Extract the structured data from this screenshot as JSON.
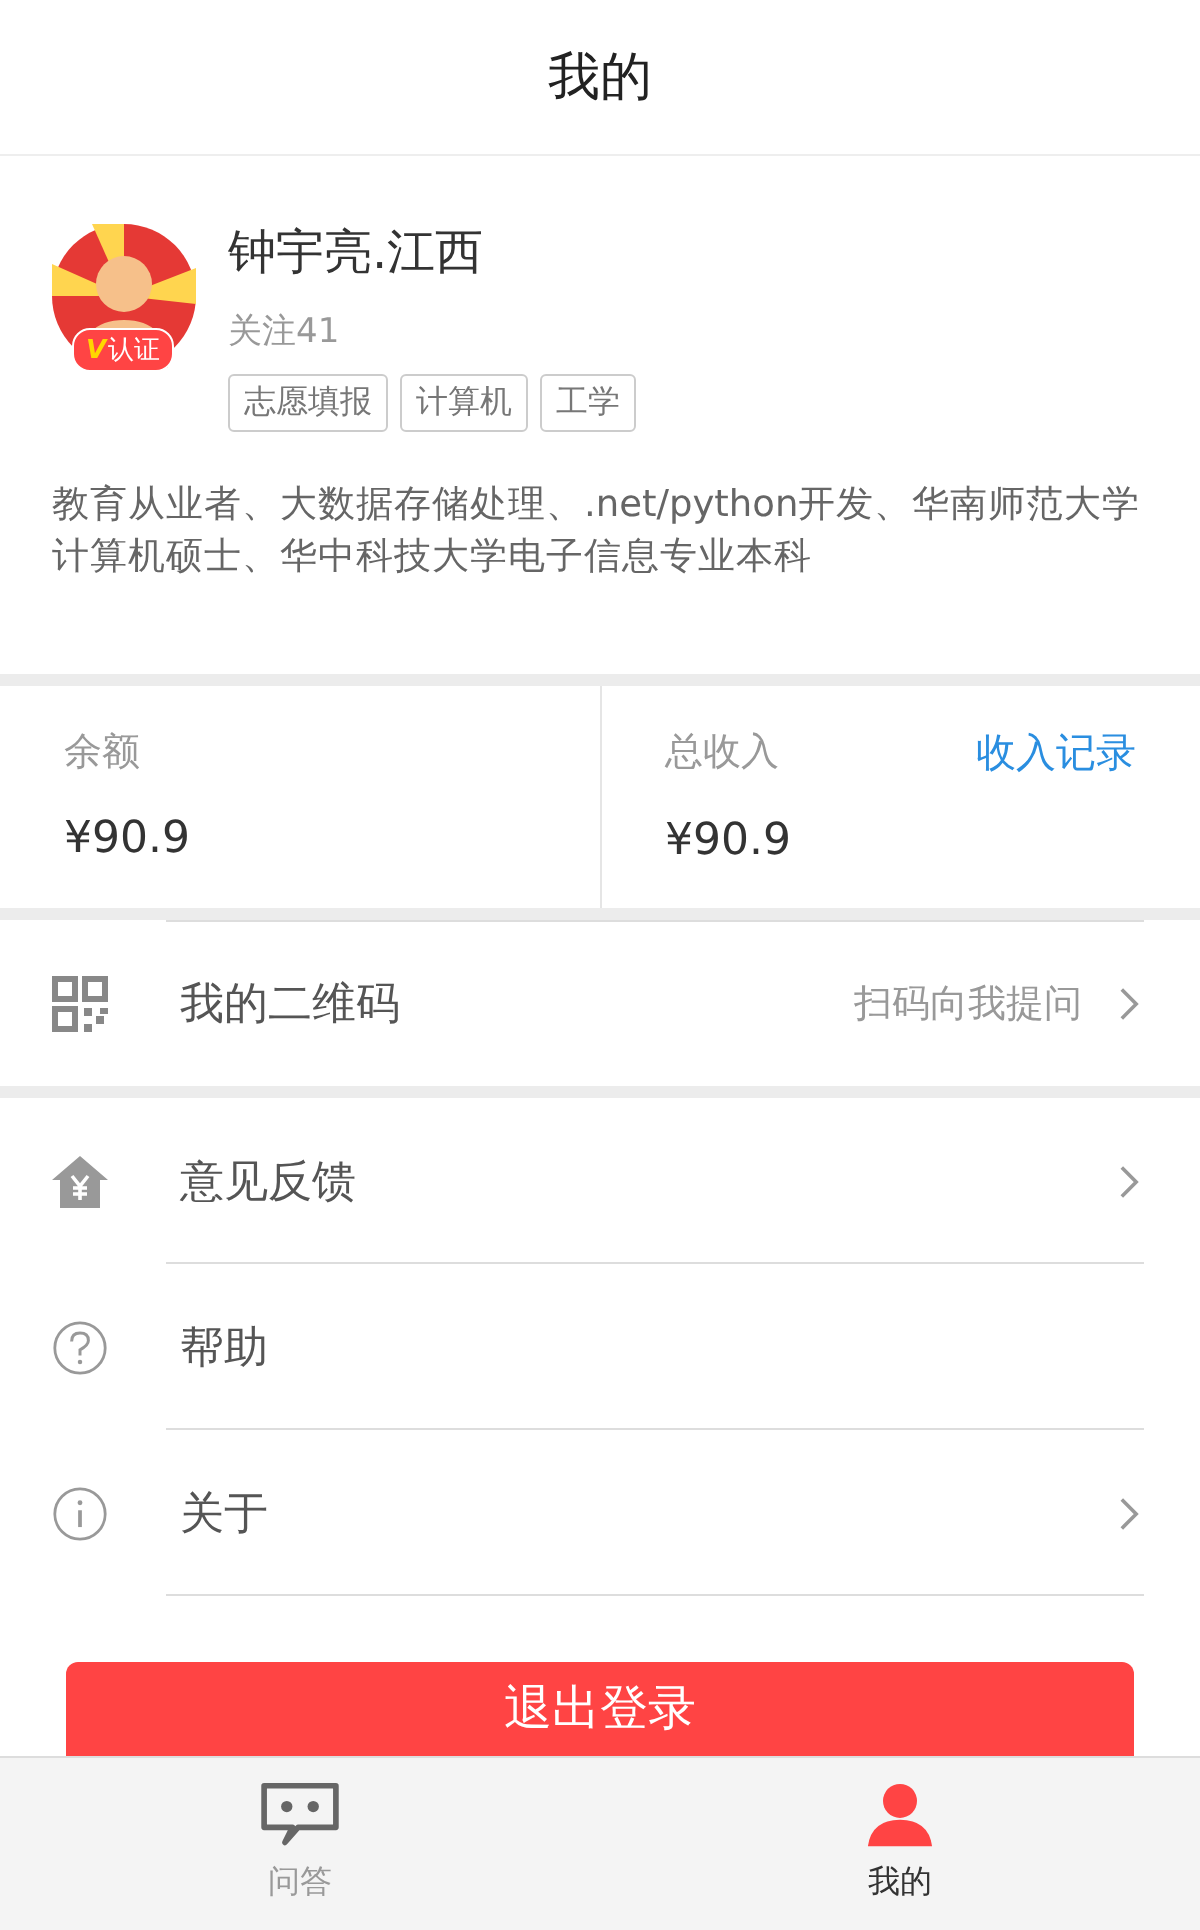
{
  "header": {
    "title": "我的"
  },
  "profile": {
    "name": "钟宇亮.江西",
    "badge_mark": "V",
    "badge": "认证",
    "follow": "关注41",
    "tags": [
      "志愿填报",
      "计算机",
      "工学"
    ],
    "bio": "教育从业者、大数据存储处理、.net/python开发、华南师范大学计算机硕士、华中科技大学电子信息专业本科"
  },
  "balance": {
    "items": [
      {
        "label": "余额",
        "value": "¥90.9"
      },
      {
        "label": "总收入",
        "value": "¥90.9",
        "link": "收入记录"
      }
    ]
  },
  "qr_row": {
    "label": "我的二维码",
    "note": "扫码向我提问",
    "arrow": true
  },
  "menu": [
    {
      "label": "意见反馈",
      "arrow": true
    },
    {
      "label": "帮助",
      "arrow": false
    },
    {
      "label": "关于",
      "arrow": true
    }
  ],
  "logout": "退出登录",
  "tabs": [
    {
      "label": "问答",
      "selected": false
    },
    {
      "label": "我的",
      "selected": true
    }
  ]
}
